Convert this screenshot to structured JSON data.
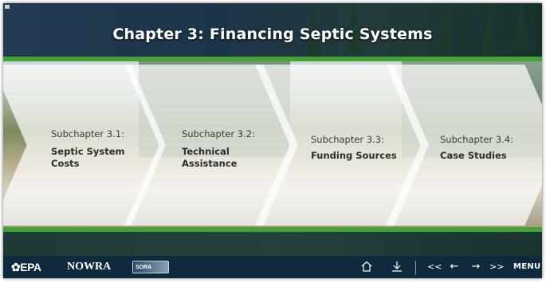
{
  "header": {
    "title": "Chapter 3: Financing Septic Systems"
  },
  "subchapters": [
    {
      "label": "Subchapter 3.1:",
      "title": "Septic System Costs"
    },
    {
      "label": "Subchapter 3.2:",
      "title": "Technical Assistance"
    },
    {
      "label": "Subchapter 3.3:",
      "title": "Funding Sources"
    },
    {
      "label": "Subchapter 3.4:",
      "title": "Case Studies"
    }
  ],
  "footer": {
    "logos": {
      "epa": "EPA",
      "nowra": "NOWRA",
      "sora": "SORA"
    },
    "nav": {
      "home_icon": "home-icon",
      "download_icon": "download-icon",
      "first_label": "<<",
      "prev_label": "←",
      "next_label": "→",
      "last_label": ">>",
      "menu_label": "MENU"
    }
  },
  "colors": {
    "accent_green": "#43a335",
    "toolbar_navy": "#0e2a3c"
  }
}
